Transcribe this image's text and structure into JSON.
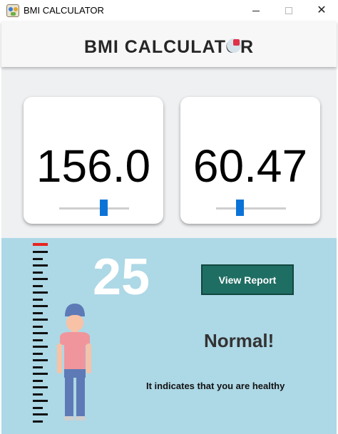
{
  "window": {
    "title": "BMI CALCULATOR",
    "icon": "app-logo-icon"
  },
  "header": {
    "title": "BMI CALCULATOR"
  },
  "height_card": {
    "value": "156.0",
    "slider_level": 0.65
  },
  "weight_card": {
    "value": "60.47",
    "slider_level": 0.32
  },
  "result": {
    "bmi": "25",
    "status": "Normal!",
    "message": "It indicates that you are healthy",
    "report_button": "View Report"
  },
  "colors": {
    "report_button": "#1f6e63",
    "result_background": "#add8e6",
    "slider_thumb": "#0b73d8",
    "ruler_top": "#e8251f"
  },
  "icons": [
    "app-logo-icon",
    "minimize-icon",
    "maximize-icon",
    "close-icon",
    "ruler-icon",
    "person-icon"
  ]
}
